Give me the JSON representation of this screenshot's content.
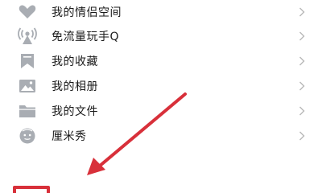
{
  "menu": {
    "items": [
      {
        "label": "我的情侣空间",
        "icon": "heart-icon"
      },
      {
        "label": "免流量玩手Q",
        "icon": "signal-tower-icon"
      },
      {
        "label": "我的收藏",
        "icon": "bookmark-icon"
      },
      {
        "label": "我的相册",
        "icon": "photo-icon"
      },
      {
        "label": "我的文件",
        "icon": "folder-icon"
      },
      {
        "label": "厘米秀",
        "icon": "face-icon"
      }
    ],
    "chevron": "›"
  },
  "colors": {
    "icon": "#a9adb3",
    "text": "#1a1a1a",
    "chevron": "#b8b8b8",
    "annotation": "#d8303a"
  }
}
